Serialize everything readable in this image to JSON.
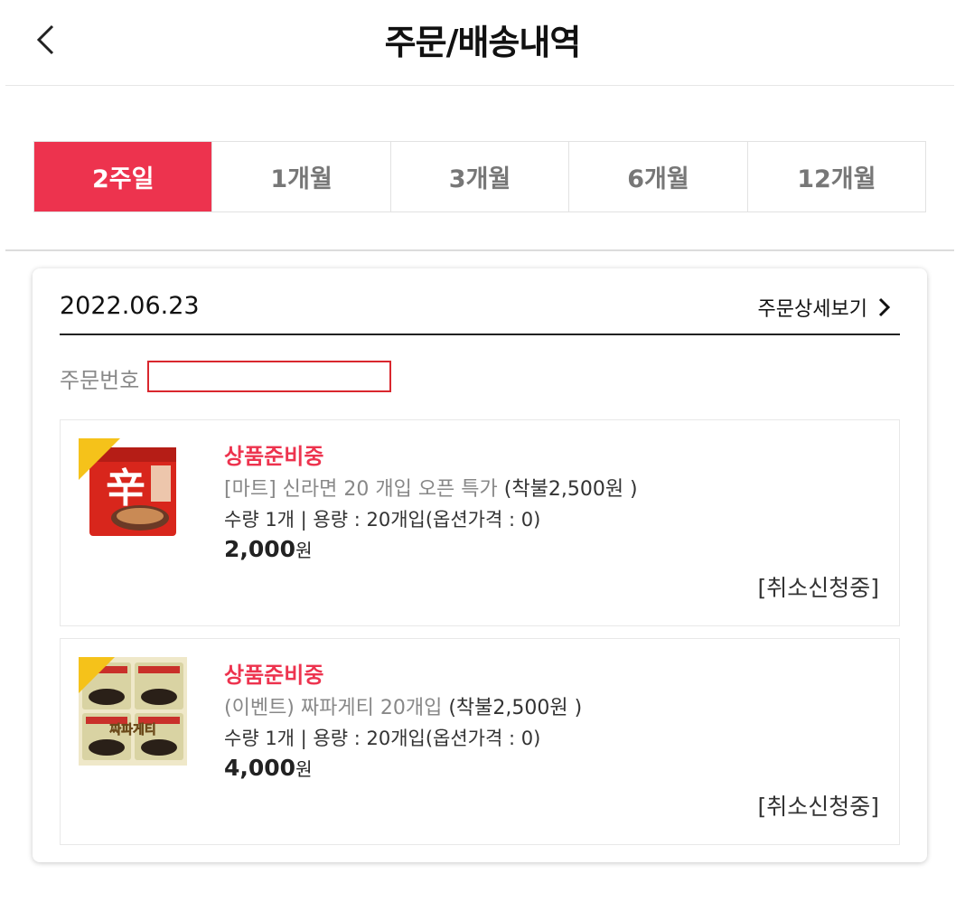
{
  "header": {
    "title": "주문/배송내역",
    "back_icon": "chevron-left-icon"
  },
  "period_tabs": [
    {
      "label": "2주일",
      "active": true
    },
    {
      "label": "1개월",
      "active": false
    },
    {
      "label": "3개월",
      "active": false
    },
    {
      "label": "6개월",
      "active": false
    },
    {
      "label": "12개월",
      "active": false
    }
  ],
  "order": {
    "date": "2022.06.23",
    "detail_link_label": "주문상세보기",
    "detail_icon": "chevron-right-icon",
    "order_number_label": "주문번호",
    "order_number_value": "",
    "items": [
      {
        "status": "상품준비중",
        "name": "[마트] 신라면 20 개입 오픈 특가",
        "shipping": "(착불2,500원 )",
        "options": "수량 1개  | 용량 : 20개입(옵션가격 : 0)",
        "price": "2,000",
        "price_unit": "원",
        "cancel_status": "[취소신청중]",
        "thumb_icon": "shin-ramyun-product-image",
        "thumb_glyph": "辛"
      },
      {
        "status": "상품준비중",
        "name": "(이벤트) 짜파게티 20개입",
        "shipping": "(착불2,500원 )",
        "options": "수량 1개  | 용량 : 20개입(옵션가격 : 0)",
        "price": "4,000",
        "price_unit": "원",
        "cancel_status": "[취소신청중]",
        "thumb_icon": "chapagetti-product-image",
        "thumb_glyph": "짜파게티"
      }
    ]
  },
  "colors": {
    "accent": "#ed334e",
    "redact_box": "#d9272e"
  }
}
